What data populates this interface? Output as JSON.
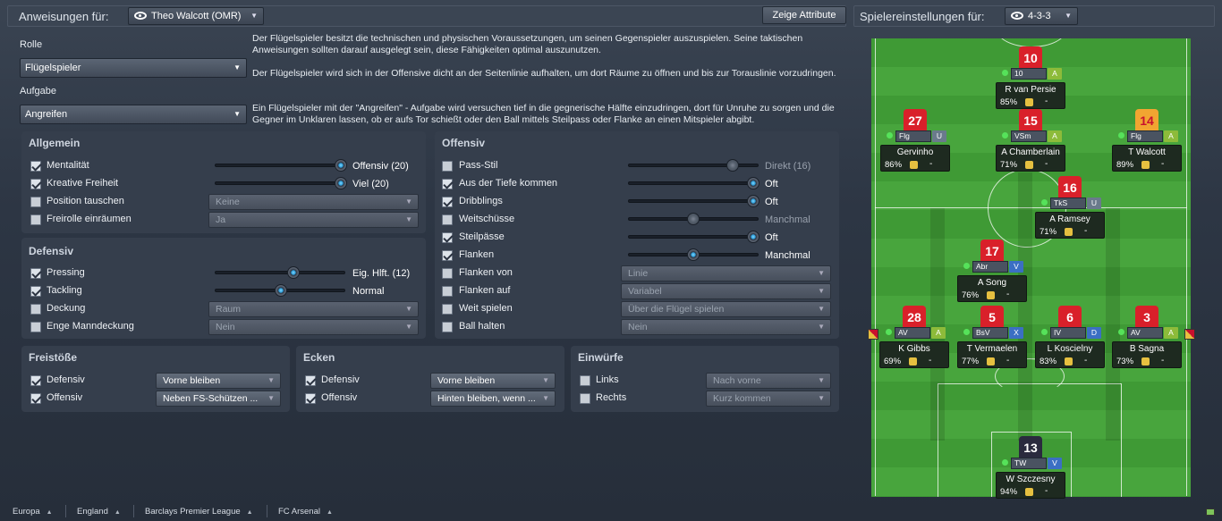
{
  "header": {
    "instructions_label": "Anweisungen für:",
    "player_select": "Theo Walcott (OMR)",
    "show_attributes": "Zeige Attribute",
    "settings_label": "Spielereinstellungen für:",
    "formation_select": "4-3-3"
  },
  "role": {
    "role_label": "Rolle",
    "role_value": "Flügelspieler",
    "task_label": "Aufgabe",
    "task_value": "Angreifen"
  },
  "description": {
    "p1": "Der Flügelspieler besitzt die technischen und physischen Voraussetzungen, um seinen Gegenspieler auszuspielen. Seine taktischen Anweisungen sollten darauf ausgelegt sein, diese Fähigkeiten optimal auszunutzen.",
    "p2": "Der Flügelspieler wird sich in der Offensive dicht an der Seitenlinie aufhalten, um dort Räume zu öffnen und bis zur Torauslinie vorzudringen.",
    "p3": "Ein Flügelspieler mit der \"Angreifen\" - Aufgabe wird versuchen tief in die gegnerische Hälfte einzudringen, dort für Unruhe zu sorgen und die Gegner im Unklaren lassen, ob er aufs Tor schießt oder den Ball mittels Steilpass oder Flanke an einen Mitspieler abgibt."
  },
  "general": {
    "title": "Allgemein",
    "mentality": {
      "label": "Mentalität",
      "value": "Offensiv (20)",
      "level": 1.0,
      "checked": true
    },
    "creative": {
      "label": "Kreative Freiheit",
      "value": "Viel (20)",
      "level": 1.0,
      "checked": true
    },
    "swap": {
      "label": "Position tauschen",
      "value": "Keine",
      "checked": false
    },
    "free_role": {
      "label": "Freirolle einräumen",
      "value": "Ja",
      "checked": false
    }
  },
  "defensive": {
    "title": "Defensiv",
    "pressing": {
      "label": "Pressing",
      "value": "Eig. Hlft. (12)",
      "level": 0.6,
      "checked": true
    },
    "tackling": {
      "label": "Tackling",
      "value": "Normal",
      "level": 0.5,
      "checked": true
    },
    "marking": {
      "label": "Deckung",
      "value": "Raum",
      "checked": false
    },
    "tight": {
      "label": "Enge Manndeckung",
      "value": "Nein",
      "checked": false
    }
  },
  "offensive": {
    "title": "Offensiv",
    "passing": {
      "label": "Pass-Stil",
      "value": "Direkt (16)",
      "level": 0.8,
      "checked": false
    },
    "deep": {
      "label": "Aus der Tiefe kommen",
      "value": "Oft",
      "level": 1.0,
      "checked": true
    },
    "dribbling": {
      "label": "Dribblings",
      "value": "Oft",
      "level": 1.0,
      "checked": true
    },
    "longshots": {
      "label": "Weitschüsse",
      "value": "Manchmal",
      "level": 0.5,
      "checked": false
    },
    "throughballs": {
      "label": "Steilpässe",
      "value": "Oft",
      "level": 1.0,
      "checked": true
    },
    "crossing": {
      "label": "Flanken",
      "value": "Manchmal",
      "level": 0.5,
      "checked": true
    },
    "cross_from": {
      "label": "Flanken von",
      "value": "Linie",
      "checked": false
    },
    "cross_to": {
      "label": "Flanken auf",
      "value": "Variabel",
      "checked": false
    },
    "wide": {
      "label": "Weit spielen",
      "value": "Über die Flügel spielen",
      "checked": false
    },
    "hold": {
      "label": "Ball halten",
      "value": "Nein",
      "checked": false
    }
  },
  "freekicks": {
    "title": "Freistöße",
    "def_label": "Defensiv",
    "def_value": "Vorne bleiben",
    "off_label": "Offensiv",
    "off_value": "Neben FS-Schützen ..."
  },
  "corners": {
    "title": "Ecken",
    "def_label": "Defensiv",
    "def_value": "Vorne bleiben",
    "off_label": "Offensiv",
    "off_value": "Hinten bleiben, wenn ..."
  },
  "throwins": {
    "title": "Einwürfe",
    "left_label": "Links",
    "left_value": "Nach vorne",
    "right_label": "Rechts",
    "right_value": "Kurz kommen"
  },
  "players": [
    {
      "id": "vp",
      "num": "10",
      "role": "10",
      "duty": "A",
      "name": "R van Persie",
      "cond": "85%",
      "morale": "-",
      "shirt": "red"
    },
    {
      "id": "gv",
      "num": "27",
      "role": "Flg",
      "duty": "U",
      "name": "Gervinho",
      "cond": "86%",
      "morale": "-",
      "shirt": "red"
    },
    {
      "id": "ac",
      "num": "15",
      "role": "VSm",
      "duty": "A",
      "name": "A Chamberlain",
      "cond": "71%",
      "morale": "-",
      "shirt": "red"
    },
    {
      "id": "tw",
      "num": "14",
      "role": "Flg",
      "duty": "A",
      "name": "T Walcott",
      "cond": "89%",
      "morale": "-",
      "shirt": "yel"
    },
    {
      "id": "ar",
      "num": "16",
      "role": "TkS",
      "duty": "U",
      "name": "A Ramsey",
      "cond": "71%",
      "morale": "-",
      "shirt": "red"
    },
    {
      "id": "as",
      "num": "17",
      "role": "Abr",
      "duty": "V",
      "name": "A Song",
      "cond": "76%",
      "morale": "-",
      "shirt": "red"
    },
    {
      "id": "kg",
      "num": "28",
      "role": "AV",
      "duty": "A",
      "name": "K Gibbs",
      "cond": "69%",
      "morale": "-",
      "shirt": "red"
    },
    {
      "id": "tv",
      "num": "5",
      "role": "BsV",
      "duty": "X",
      "name": "T Vermaelen",
      "cond": "77%",
      "morale": "-",
      "shirt": "red"
    },
    {
      "id": "lk",
      "num": "6",
      "role": "IV",
      "duty": "D",
      "name": "L Koscielny",
      "cond": "83%",
      "morale": "-",
      "shirt": "red"
    },
    {
      "id": "bs",
      "num": "3",
      "role": "AV",
      "duty": "A",
      "name": "B Sagna",
      "cond": "73%",
      "morale": "-",
      "shirt": "red"
    },
    {
      "id": "ws",
      "num": "13",
      "role": "TW",
      "duty": "V",
      "name": "W Szczesny",
      "cond": "94%",
      "morale": "-",
      "shirt": "blk"
    }
  ],
  "footer": [
    "Europa",
    "England",
    "Barclays Premier League",
    "FC Arsenal"
  ],
  "colors": {
    "accent": "#2a9ad6",
    "attack": "#8dbb3a",
    "support": "#6a7a8c",
    "defend": "#3b6fc4"
  }
}
